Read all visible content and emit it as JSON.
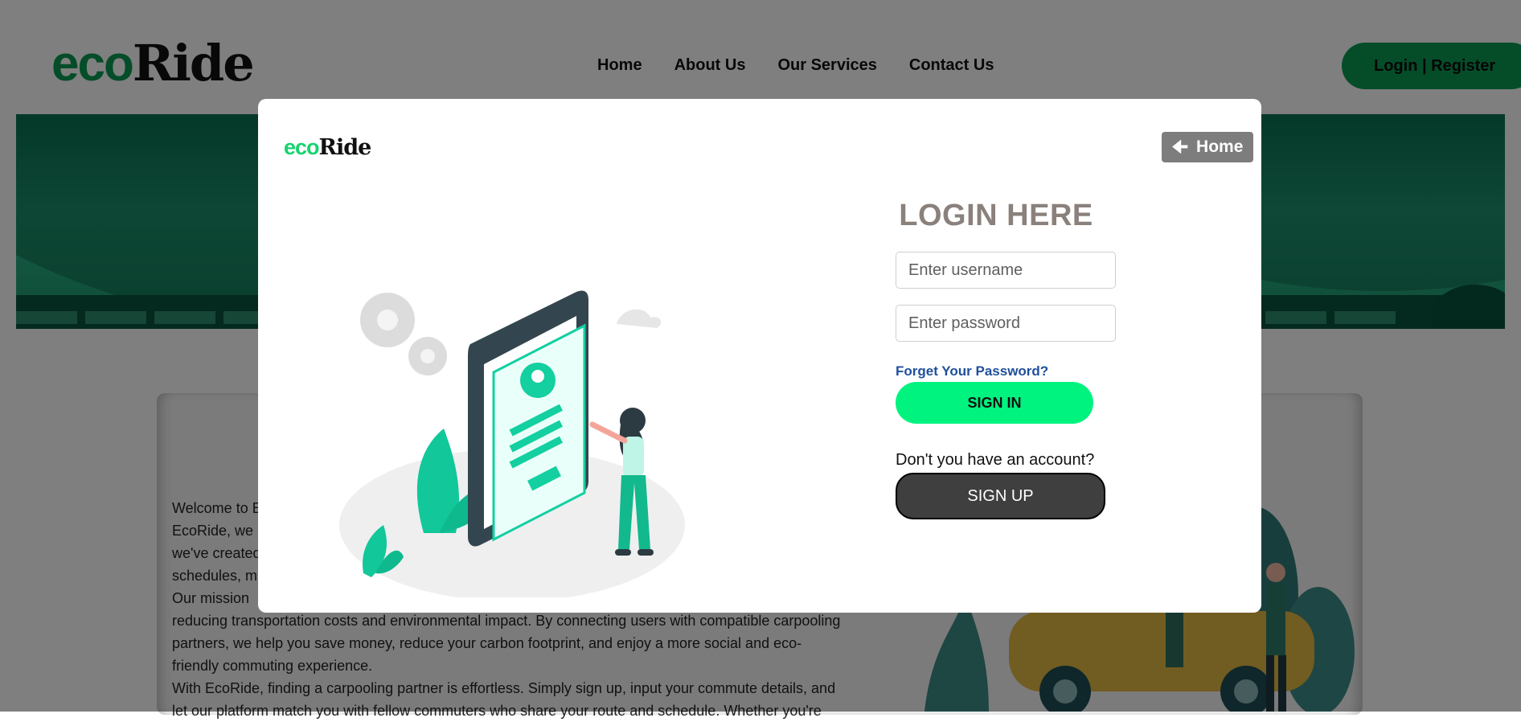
{
  "brand": {
    "eco": "eco",
    "ride": "Ride"
  },
  "nav": {
    "items": [
      "Home",
      "About Us",
      "Our Services",
      "Contact Us"
    ]
  },
  "header": {
    "login_register": "Login | Register"
  },
  "about": {
    "lines": [
      "Welcome to E",
      "EcoRide, we",
      "we've created",
      "schedules, m",
      "Our mission",
      "reducing transportation costs and environmental impact. By connecting users with compatible carpooling",
      "partners, we help you save money, reduce your carbon footprint, and enjoy a more social and eco-",
      "friendly commuting experience.",
      "With EcoRide, finding a carpooling partner is effortless. Simply sign up, input your commute details, and",
      "let our platform match you with fellow commuters who share your route and schedule. Whether you're"
    ]
  },
  "modal": {
    "home_label": "Home",
    "title": "LOGIN HERE",
    "username_placeholder": "Enter username",
    "password_placeholder": "Enter password",
    "forgot_label": "Forget Your Password?",
    "signin_label": "SIGN IN",
    "no_account_text": "Don't you have an account?",
    "signup_label": "SIGN UP"
  },
  "colors": {
    "brand_green": "#0a9a52",
    "signin_green": "#00f37f",
    "home_button": "#7d7d7d",
    "signup_button": "#3f3f3f",
    "title_gray": "#8a817c",
    "link_blue": "#1e4f9c"
  },
  "icons": {
    "home_button_icon": "left-arrow-icon"
  }
}
